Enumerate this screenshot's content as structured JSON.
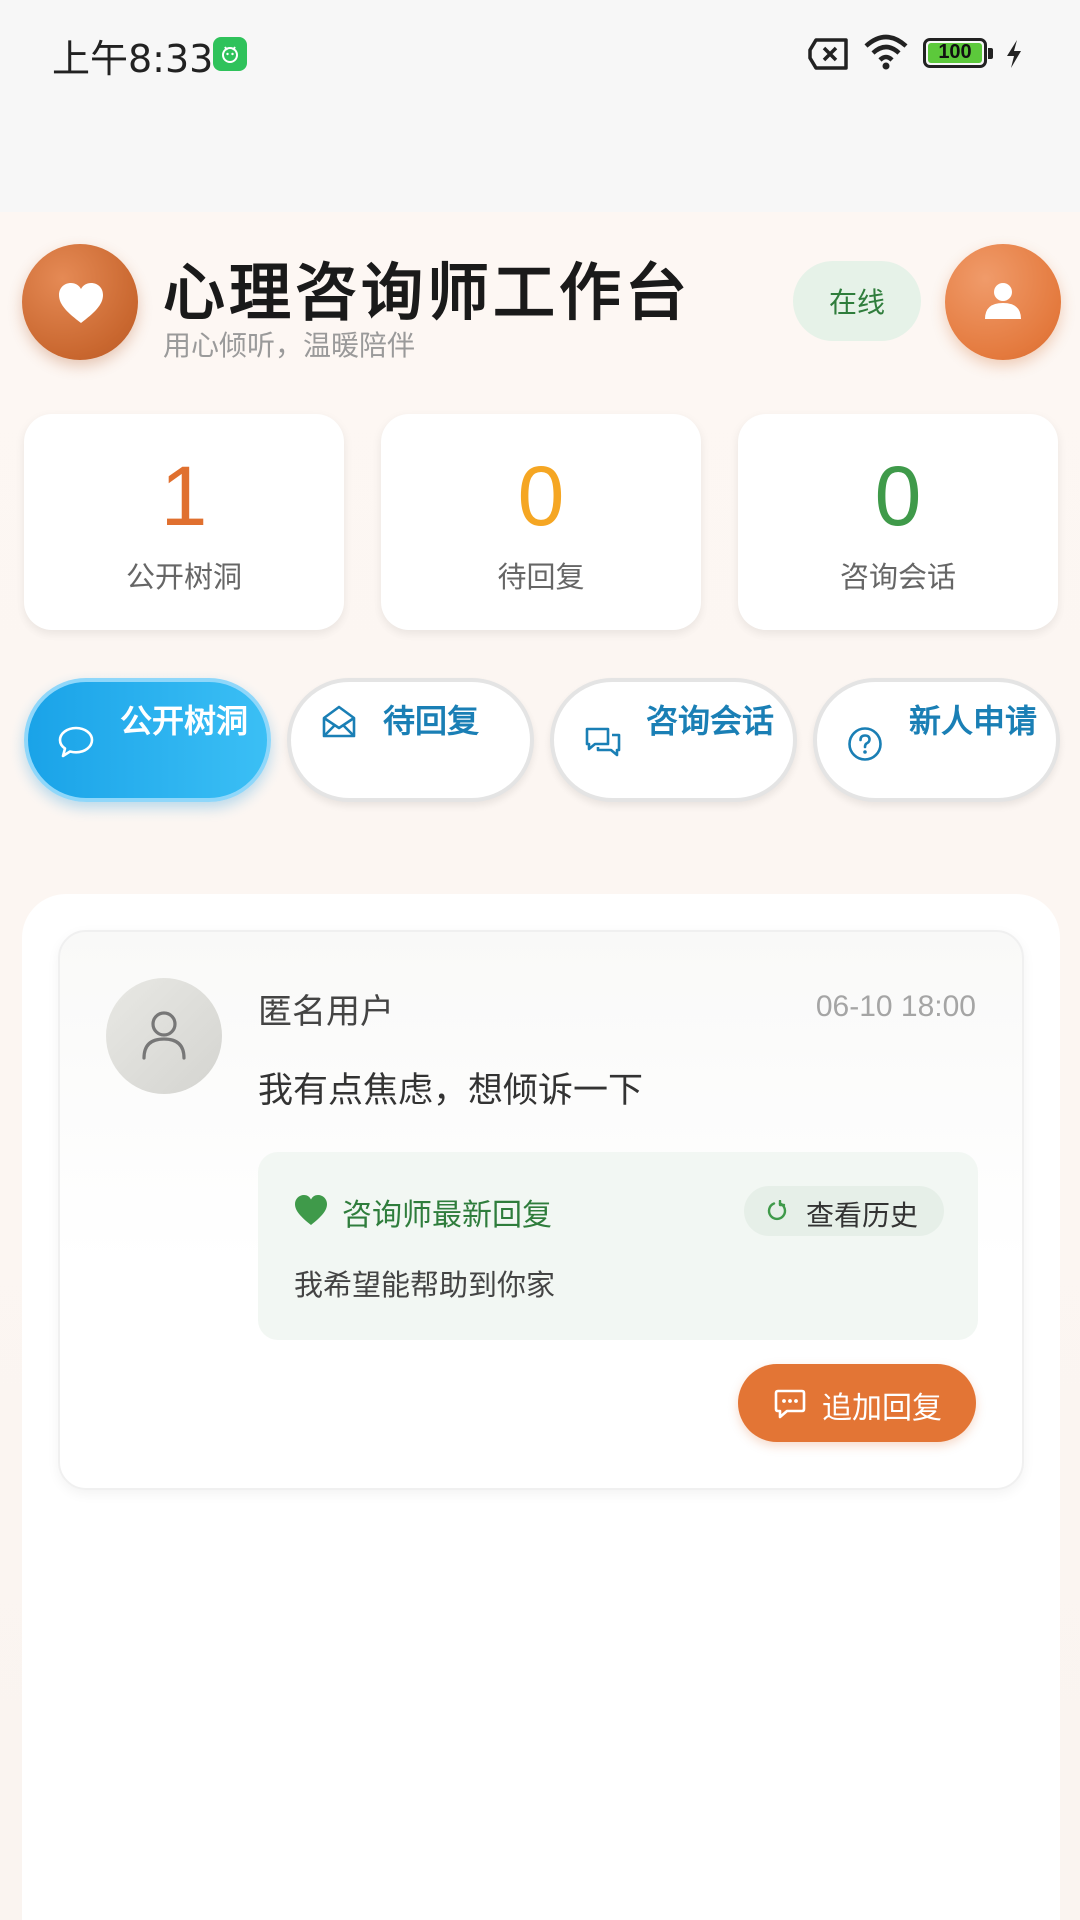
{
  "status_bar": {
    "time": "上午8:33",
    "battery": "100"
  },
  "header": {
    "title": "心理咨询师工作台",
    "subtitle": "用心倾听，温暖陪伴",
    "online_label": "在线"
  },
  "stats": [
    {
      "value": "1",
      "label": "公开树洞",
      "color": "#e0702f"
    },
    {
      "value": "0",
      "label": "待回复",
      "color": "#f5a623"
    },
    {
      "value": "0",
      "label": "咨询会话",
      "color": "#3f9a4a"
    }
  ],
  "tabs": [
    {
      "label": "公开树洞",
      "icon": "chat-bubble-icon",
      "active": true
    },
    {
      "label": "待回复",
      "icon": "envelope-open-icon",
      "active": false
    },
    {
      "label": "咨询会话",
      "icon": "chat-double-icon",
      "active": false
    },
    {
      "label": "新人申请",
      "icon": "question-circle-icon",
      "active": false
    }
  ],
  "post": {
    "user": "匿名用户",
    "time": "06-10 18:00",
    "content": "我有点焦虑，想倾诉一下",
    "reply_title": "咨询师最新回复",
    "history_label": "查看历史",
    "reply_text": "我希望能帮助到你家",
    "add_reply_label": "追加回复"
  },
  "colors": {
    "accent_orange": "#e37535",
    "accent_blue": "#1aa3e8",
    "accent_green": "#2f7d3c"
  }
}
